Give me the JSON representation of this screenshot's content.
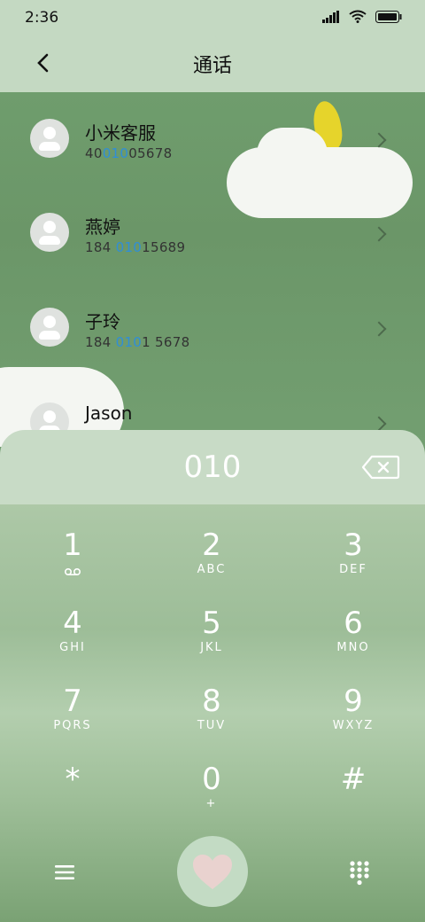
{
  "status": {
    "time": "2:36"
  },
  "header": {
    "title": "通话"
  },
  "contacts": [
    {
      "name": "小米客服",
      "num_pre": "40",
      "num_hl": "010",
      "num_post": "05678"
    },
    {
      "name": "燕婷",
      "num_pre": "184 ",
      "num_hl": "010",
      "num_post": "15689"
    },
    {
      "name": "子玲",
      "num_pre": "184 ",
      "num_hl": "010",
      "num_post": "1 5678"
    },
    {
      "name": "Jason",
      "num_pre": "",
      "num_hl": "",
      "num_post": ""
    }
  ],
  "dialer": {
    "input": "010",
    "keys": [
      {
        "digit": "1",
        "letters": ""
      },
      {
        "digit": "2",
        "letters": "ABC"
      },
      {
        "digit": "3",
        "letters": "DEF"
      },
      {
        "digit": "4",
        "letters": "GHI"
      },
      {
        "digit": "5",
        "letters": "JKL"
      },
      {
        "digit": "6",
        "letters": "MNO"
      },
      {
        "digit": "7",
        "letters": "PQRS"
      },
      {
        "digit": "8",
        "letters": "TUV"
      },
      {
        "digit": "9",
        "letters": "WXYZ"
      },
      {
        "digit": "*",
        "letters": ""
      },
      {
        "digit": "0",
        "letters": "+"
      },
      {
        "digit": "#",
        "letters": ""
      }
    ]
  },
  "colors": {
    "highlight": "#2f8ed8",
    "header_bg": "#c4d9c2"
  }
}
